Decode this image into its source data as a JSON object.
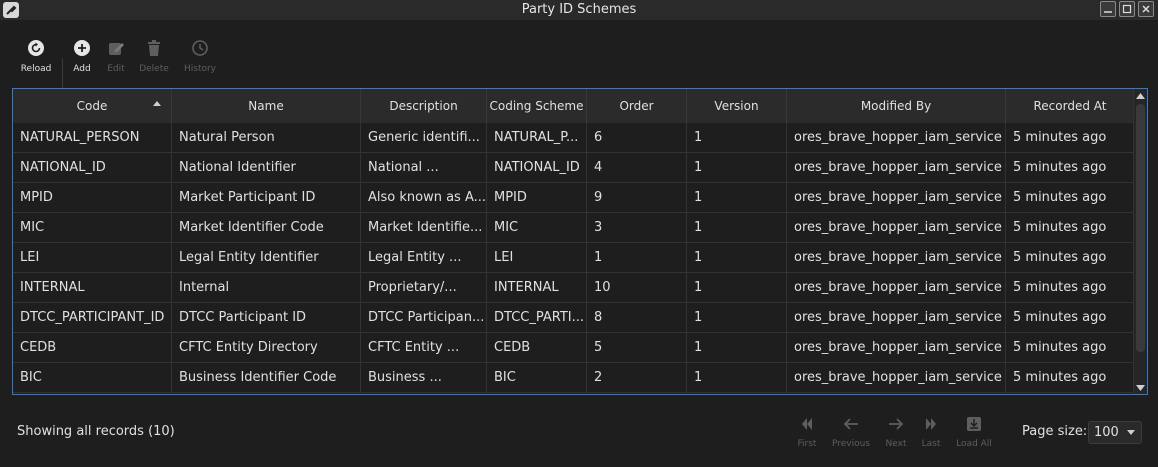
{
  "window": {
    "title": "Party ID Schemes"
  },
  "toolbar": {
    "reload": "Reload",
    "add": "Add",
    "edit": "Edit",
    "delete": "Delete",
    "history": "History"
  },
  "table": {
    "columns": [
      "Code",
      "Name",
      "Description",
      "Coding Scheme",
      "Order",
      "Version",
      "Modified By",
      "Recorded At"
    ],
    "rows": [
      [
        "NATURAL_PERSON",
        "Natural Person",
        "Generic identifi...",
        "NATURAL_P...",
        "6",
        "1",
        "ores_brave_hopper_iam_service",
        "5 minutes ago"
      ],
      [
        "NATIONAL_ID",
        "National Identifier",
        "National ...",
        "NATIONAL_ID",
        "4",
        "1",
        "ores_brave_hopper_iam_service",
        "5 minutes ago"
      ],
      [
        "MPID",
        "Market Participant ID",
        "Also known as A...",
        "MPID",
        "9",
        "1",
        "ores_brave_hopper_iam_service",
        "5 minutes ago"
      ],
      [
        "MIC",
        "Market Identifier Code",
        "Market Identifie...",
        "MIC",
        "3",
        "1",
        "ores_brave_hopper_iam_service",
        "5 minutes ago"
      ],
      [
        "LEI",
        "Legal Entity Identifier",
        "Legal Entity ...",
        "LEI",
        "1",
        "1",
        "ores_brave_hopper_iam_service",
        "5 minutes ago"
      ],
      [
        "INTERNAL",
        "Internal",
        "Proprietary/...",
        "INTERNAL",
        "10",
        "1",
        "ores_brave_hopper_iam_service",
        "5 minutes ago"
      ],
      [
        "DTCC_PARTICIPANT_ID",
        "DTCC Participant ID",
        "DTCC Participan...",
        "DTCC_PARTI...",
        "8",
        "1",
        "ores_brave_hopper_iam_service",
        "5 minutes ago"
      ],
      [
        "CEDB",
        "CFTC Entity Directory",
        "CFTC Entity ...",
        "CEDB",
        "5",
        "1",
        "ores_brave_hopper_iam_service",
        "5 minutes ago"
      ],
      [
        "BIC",
        "Business Identifier Code",
        "Business ...",
        "BIC",
        "2",
        "1",
        "ores_brave_hopper_iam_service",
        "5 minutes ago"
      ]
    ]
  },
  "footer": {
    "status": "Showing all records (10)",
    "first": "First",
    "previous": "Previous",
    "next": "Next",
    "last": "Last",
    "load_all": "Load All",
    "page_size_label": "Page size:",
    "page_size_value": "100"
  },
  "colors": {
    "accent": "#2e7bd1",
    "background": "#1e1e1e",
    "header_bg": "#2b2b2b"
  },
  "icons": {
    "reload": "reload-icon",
    "add": "add-icon",
    "edit": "edit-icon",
    "delete": "trash-icon",
    "history": "history-icon",
    "first": "first-page-icon",
    "previous": "arrow-left-icon",
    "next": "arrow-right-icon",
    "last": "last-page-icon",
    "load_all": "download-icon"
  }
}
